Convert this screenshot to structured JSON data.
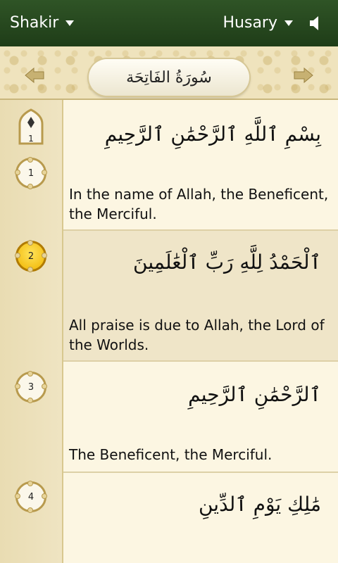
{
  "topbar": {
    "translation_selector": "Shakir",
    "reciter_selector": "Husary",
    "volume_icon": "speaker-icon"
  },
  "banner": {
    "surah_title": "سُورَةُ الفَاتِحَة",
    "prev_icon": "arrow-left-icon",
    "next_icon": "arrow-right-icon"
  },
  "juz_marker": {
    "label": "1"
  },
  "ayahs": [
    {
      "number": "1",
      "arabic": "بِسْمِ ٱللَّهِ ٱلرَّحْمَٰنِ ٱلرَّحِيمِ",
      "translation": "In the name of Allah, the Beneficent, the Merciful."
    },
    {
      "number": "2",
      "arabic": "ٱلْحَمْدُ لِلَّهِ رَبِّ ٱلْعَٰلَمِينَ",
      "translation": "All praise is due to Allah, the Lord of the Worlds."
    },
    {
      "number": "3",
      "arabic": "ٱلرَّحْمَٰنِ ٱلرَّحِيمِ",
      "translation": "The Beneficent, the Merciful."
    },
    {
      "number": "4",
      "arabic": "مَٰلِكِ يَوْمِ ٱلدِّينِ",
      "translation": ""
    }
  ],
  "colors": {
    "topbar": "#1f3d18",
    "active_badge": "#f0b400",
    "paper": "#fcf6e2"
  }
}
